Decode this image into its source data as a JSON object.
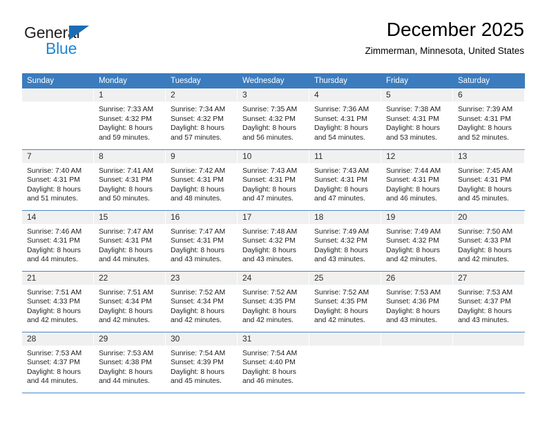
{
  "brand": {
    "name_part1": "General",
    "name_part2": "Blue",
    "triangle_icon": "triangle-icon",
    "color_dark": "#231f20",
    "color_blue": "#1e87d4"
  },
  "header": {
    "title": "December 2025",
    "subtitle": "Zimmerman, Minnesota, United States"
  },
  "theme": {
    "header_row_bg": "#3b7cbe",
    "header_row_text": "#ffffff",
    "daynum_bg": "#f0f0f0",
    "row_separator": "#4a86c4"
  },
  "calendar": {
    "weekday_headers": [
      "Sunday",
      "Monday",
      "Tuesday",
      "Wednesday",
      "Thursday",
      "Friday",
      "Saturday"
    ],
    "weeks": [
      [
        {
          "day": "",
          "sunrise": "",
          "sunset": "",
          "daylight_line1": "",
          "daylight_line2": ""
        },
        {
          "day": "1",
          "sunrise": "Sunrise: 7:33 AM",
          "sunset": "Sunset: 4:32 PM",
          "daylight_line1": "Daylight: 8 hours",
          "daylight_line2": "and 59 minutes."
        },
        {
          "day": "2",
          "sunrise": "Sunrise: 7:34 AM",
          "sunset": "Sunset: 4:32 PM",
          "daylight_line1": "Daylight: 8 hours",
          "daylight_line2": "and 57 minutes."
        },
        {
          "day": "3",
          "sunrise": "Sunrise: 7:35 AM",
          "sunset": "Sunset: 4:32 PM",
          "daylight_line1": "Daylight: 8 hours",
          "daylight_line2": "and 56 minutes."
        },
        {
          "day": "4",
          "sunrise": "Sunrise: 7:36 AM",
          "sunset": "Sunset: 4:31 PM",
          "daylight_line1": "Daylight: 8 hours",
          "daylight_line2": "and 54 minutes."
        },
        {
          "day": "5",
          "sunrise": "Sunrise: 7:38 AM",
          "sunset": "Sunset: 4:31 PM",
          "daylight_line1": "Daylight: 8 hours",
          "daylight_line2": "and 53 minutes."
        },
        {
          "day": "6",
          "sunrise": "Sunrise: 7:39 AM",
          "sunset": "Sunset: 4:31 PM",
          "daylight_line1": "Daylight: 8 hours",
          "daylight_line2": "and 52 minutes."
        }
      ],
      [
        {
          "day": "7",
          "sunrise": "Sunrise: 7:40 AM",
          "sunset": "Sunset: 4:31 PM",
          "daylight_line1": "Daylight: 8 hours",
          "daylight_line2": "and 51 minutes."
        },
        {
          "day": "8",
          "sunrise": "Sunrise: 7:41 AM",
          "sunset": "Sunset: 4:31 PM",
          "daylight_line1": "Daylight: 8 hours",
          "daylight_line2": "and 50 minutes."
        },
        {
          "day": "9",
          "sunrise": "Sunrise: 7:42 AM",
          "sunset": "Sunset: 4:31 PM",
          "daylight_line1": "Daylight: 8 hours",
          "daylight_line2": "and 48 minutes."
        },
        {
          "day": "10",
          "sunrise": "Sunrise: 7:43 AM",
          "sunset": "Sunset: 4:31 PM",
          "daylight_line1": "Daylight: 8 hours",
          "daylight_line2": "and 47 minutes."
        },
        {
          "day": "11",
          "sunrise": "Sunrise: 7:43 AM",
          "sunset": "Sunset: 4:31 PM",
          "daylight_line1": "Daylight: 8 hours",
          "daylight_line2": "and 47 minutes."
        },
        {
          "day": "12",
          "sunrise": "Sunrise: 7:44 AM",
          "sunset": "Sunset: 4:31 PM",
          "daylight_line1": "Daylight: 8 hours",
          "daylight_line2": "and 46 minutes."
        },
        {
          "day": "13",
          "sunrise": "Sunrise: 7:45 AM",
          "sunset": "Sunset: 4:31 PM",
          "daylight_line1": "Daylight: 8 hours",
          "daylight_line2": "and 45 minutes."
        }
      ],
      [
        {
          "day": "14",
          "sunrise": "Sunrise: 7:46 AM",
          "sunset": "Sunset: 4:31 PM",
          "daylight_line1": "Daylight: 8 hours",
          "daylight_line2": "and 44 minutes."
        },
        {
          "day": "15",
          "sunrise": "Sunrise: 7:47 AM",
          "sunset": "Sunset: 4:31 PM",
          "daylight_line1": "Daylight: 8 hours",
          "daylight_line2": "and 44 minutes."
        },
        {
          "day": "16",
          "sunrise": "Sunrise: 7:47 AM",
          "sunset": "Sunset: 4:31 PM",
          "daylight_line1": "Daylight: 8 hours",
          "daylight_line2": "and 43 minutes."
        },
        {
          "day": "17",
          "sunrise": "Sunrise: 7:48 AM",
          "sunset": "Sunset: 4:32 PM",
          "daylight_line1": "Daylight: 8 hours",
          "daylight_line2": "and 43 minutes."
        },
        {
          "day": "18",
          "sunrise": "Sunrise: 7:49 AM",
          "sunset": "Sunset: 4:32 PM",
          "daylight_line1": "Daylight: 8 hours",
          "daylight_line2": "and 43 minutes."
        },
        {
          "day": "19",
          "sunrise": "Sunrise: 7:49 AM",
          "sunset": "Sunset: 4:32 PM",
          "daylight_line1": "Daylight: 8 hours",
          "daylight_line2": "and 42 minutes."
        },
        {
          "day": "20",
          "sunrise": "Sunrise: 7:50 AM",
          "sunset": "Sunset: 4:33 PM",
          "daylight_line1": "Daylight: 8 hours",
          "daylight_line2": "and 42 minutes."
        }
      ],
      [
        {
          "day": "21",
          "sunrise": "Sunrise: 7:51 AM",
          "sunset": "Sunset: 4:33 PM",
          "daylight_line1": "Daylight: 8 hours",
          "daylight_line2": "and 42 minutes."
        },
        {
          "day": "22",
          "sunrise": "Sunrise: 7:51 AM",
          "sunset": "Sunset: 4:34 PM",
          "daylight_line1": "Daylight: 8 hours",
          "daylight_line2": "and 42 minutes."
        },
        {
          "day": "23",
          "sunrise": "Sunrise: 7:52 AM",
          "sunset": "Sunset: 4:34 PM",
          "daylight_line1": "Daylight: 8 hours",
          "daylight_line2": "and 42 minutes."
        },
        {
          "day": "24",
          "sunrise": "Sunrise: 7:52 AM",
          "sunset": "Sunset: 4:35 PM",
          "daylight_line1": "Daylight: 8 hours",
          "daylight_line2": "and 42 minutes."
        },
        {
          "day": "25",
          "sunrise": "Sunrise: 7:52 AM",
          "sunset": "Sunset: 4:35 PM",
          "daylight_line1": "Daylight: 8 hours",
          "daylight_line2": "and 42 minutes."
        },
        {
          "day": "26",
          "sunrise": "Sunrise: 7:53 AM",
          "sunset": "Sunset: 4:36 PM",
          "daylight_line1": "Daylight: 8 hours",
          "daylight_line2": "and 43 minutes."
        },
        {
          "day": "27",
          "sunrise": "Sunrise: 7:53 AM",
          "sunset": "Sunset: 4:37 PM",
          "daylight_line1": "Daylight: 8 hours",
          "daylight_line2": "and 43 minutes."
        }
      ],
      [
        {
          "day": "28",
          "sunrise": "Sunrise: 7:53 AM",
          "sunset": "Sunset: 4:37 PM",
          "daylight_line1": "Daylight: 8 hours",
          "daylight_line2": "and 44 minutes."
        },
        {
          "day": "29",
          "sunrise": "Sunrise: 7:53 AM",
          "sunset": "Sunset: 4:38 PM",
          "daylight_line1": "Daylight: 8 hours",
          "daylight_line2": "and 44 minutes."
        },
        {
          "day": "30",
          "sunrise": "Sunrise: 7:54 AM",
          "sunset": "Sunset: 4:39 PM",
          "daylight_line1": "Daylight: 8 hours",
          "daylight_line2": "and 45 minutes."
        },
        {
          "day": "31",
          "sunrise": "Sunrise: 7:54 AM",
          "sunset": "Sunset: 4:40 PM",
          "daylight_line1": "Daylight: 8 hours",
          "daylight_line2": "and 46 minutes."
        },
        {
          "day": "",
          "sunrise": "",
          "sunset": "",
          "daylight_line1": "",
          "daylight_line2": ""
        },
        {
          "day": "",
          "sunrise": "",
          "sunset": "",
          "daylight_line1": "",
          "daylight_line2": ""
        },
        {
          "day": "",
          "sunrise": "",
          "sunset": "",
          "daylight_line1": "",
          "daylight_line2": ""
        }
      ]
    ]
  }
}
